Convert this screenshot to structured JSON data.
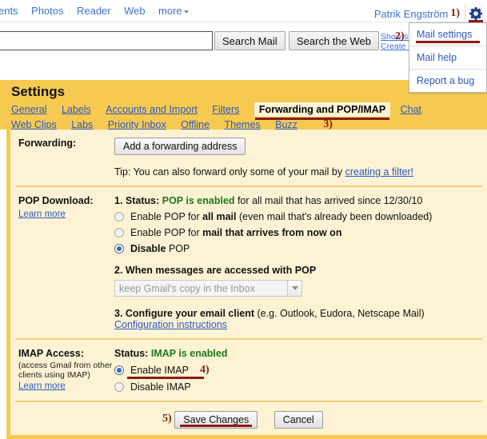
{
  "topnav": {
    "links": [
      {
        "label": "ents",
        "name": "nav-documents"
      },
      {
        "label": "Photos",
        "name": "nav-photos"
      },
      {
        "label": "Reader",
        "name": "nav-reader"
      },
      {
        "label": "Web",
        "name": "nav-web"
      }
    ],
    "more_label": "more",
    "username": "Patrik Engström",
    "gear_icon": "gear-icon"
  },
  "search": {
    "value": "",
    "placeholder": "",
    "search_mail_label": "Search Mail",
    "search_web_label": "Search the Web",
    "show_options_label": "Show se",
    "create_filter_label": "Create a"
  },
  "dropdown": {
    "items": [
      {
        "label": "Mail settings",
        "name": "menu-item-mail-settings"
      },
      {
        "label": "Mail help",
        "name": "menu-item-mail-help"
      },
      {
        "label": "Report a bug",
        "name": "menu-item-report-a-bug"
      }
    ]
  },
  "settings": {
    "title": "Settings",
    "tabs_row1": [
      {
        "label": "General",
        "active": false
      },
      {
        "label": "Labels",
        "active": false
      },
      {
        "label": "Accounts and Import",
        "active": false
      },
      {
        "label": "Filters",
        "active": false
      },
      {
        "label": "Forwarding and POP/IMAP",
        "active": true
      },
      {
        "label": "Chat",
        "active": false
      }
    ],
    "tabs_row2": [
      {
        "label": "Web Clips",
        "active": false
      },
      {
        "label": "Labs",
        "active": false
      },
      {
        "label": "Priority Inbox",
        "active": false
      },
      {
        "label": "Offline",
        "active": false
      },
      {
        "label": "Themes",
        "active": false
      },
      {
        "label": "Buzz",
        "active": false
      }
    ]
  },
  "forwarding": {
    "label": "Forwarding:",
    "add_button_label": "Add a forwarding address",
    "tip_prefix": "Tip: You can also forward only some of your mail by ",
    "tip_link": "creating a filter!"
  },
  "pop": {
    "label": "POP Download:",
    "learn_more": "Learn more",
    "step1_prefix": "1. Status: ",
    "step1_status": "POP is enabled",
    "step1_suffix": " for all mail that has arrived since 12/30/10",
    "option_all_prefix": "Enable POP for ",
    "option_all_bold": "all mail",
    "option_all_suffix": " (even mail that's already been downloaded)",
    "option_now_prefix": "Enable POP for ",
    "option_now_bold": "mail that arrives from now on",
    "option_disable_bold": "Disable",
    "option_disable_suffix": " POP",
    "selected": "disable",
    "step2_title": "2. When messages are accessed with POP",
    "step2_select_value": "keep Gmail's copy in the Inbox",
    "step2_select_disabled": true,
    "step3_bold": "3. Configure your email client",
    "step3_rest": " (e.g. Outlook, Eudora, Netscape Mail)",
    "step3_link": "Configuration instructions"
  },
  "imap": {
    "label": "IMAP Access:",
    "sub1": "(access Gmail from other",
    "sub2": "clients using IMAP)",
    "learn_more": "Learn more",
    "status_prefix": "Status: ",
    "status_value": "IMAP is enabled",
    "option_enable": "Enable IMAP",
    "option_disable": "Disable IMAP",
    "selected": "enable"
  },
  "footer": {
    "save_label": "Save Changes",
    "cancel_label": "Cancel"
  },
  "annotations": {
    "a1": "1)",
    "a2": "2)",
    "a3": "3)",
    "a4": "4)",
    "a5": "5)"
  },
  "colors": {
    "header_band": "#f6ca51",
    "panel_bg": "#fdf3d4",
    "link_blue": "#2b59c3",
    "annotation_red": "#8c1b17",
    "status_green": "#1b7a1b",
    "radio_blue": "#2468d4"
  }
}
